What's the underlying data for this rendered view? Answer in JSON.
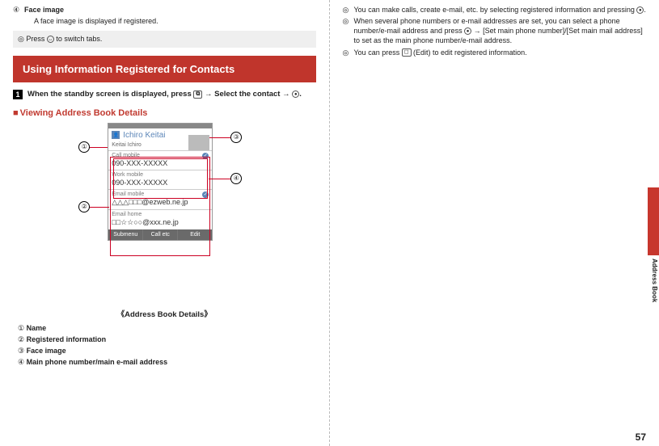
{
  "left": {
    "item4": {
      "num": "④",
      "title": "Face image",
      "desc": "A face image is displayed if registered."
    },
    "note": {
      "sym": "◎",
      "text_a": "Press ",
      "key": "↔",
      "text_b": " to switch tabs."
    },
    "banner": "Using Information Registered for Contacts",
    "step": {
      "num": "1",
      "text_a": "When the standby screen is displayed, press ",
      "key1": "⧉",
      "arrow": " → ",
      "text_b": "Select the contact → ",
      "key2": "●",
      "text_c": "."
    },
    "subhead": {
      "sq": "■",
      "text": "Viewing Address Book Details"
    },
    "phone": {
      "name": "Ichiro Keitai",
      "reading": "Keitai Ichiro",
      "s1_lbl": "Call mobile",
      "s1_val": "090-XXX-XXXXX",
      "s2_lbl": "Work mobile",
      "s2_val": "090-XXX-XXXXX",
      "s3_lbl": "Email mobile",
      "s3_val": "△△△□□□@ezweb.ne.jp",
      "s4_lbl": "Email home",
      "s4_val": "□□☆☆○○@xxx.ne.jp",
      "sk1": "Submenu",
      "sk2": "Call etc",
      "sk3": "Edit"
    },
    "callouts": {
      "c1": "①",
      "c2": "②",
      "c3": "③",
      "c4": "④"
    },
    "caption": "《Address Book Details》",
    "legend": {
      "l1n": "①",
      "l1t": "Name",
      "l2n": "②",
      "l2t": "Registered information",
      "l3n": "③",
      "l3t": "Face image",
      "l4n": "④",
      "l4t": "Main phone number/main e-mail address"
    }
  },
  "right": {
    "n1": {
      "sym": "◎",
      "text_a": "You can make calls, create e-mail, etc. by selecting registered information and pressing ",
      "key": "●",
      "text_b": "."
    },
    "n2": {
      "sym": "◎",
      "text_a": "When several phone numbers or e-mail addresses are set, you can select a phone number/e-mail address and press ",
      "key": "●",
      "arrow": " → ",
      "text_b": "[Set main phone number]/[Set main mail address] to set as the main phone number/e-mail address."
    },
    "n3": {
      "sym": "◎",
      "text_a": "You can press ",
      "key": "◻",
      "text_b": " (Edit) to edit registered information."
    }
  },
  "side": "Address Book",
  "page": "57"
}
